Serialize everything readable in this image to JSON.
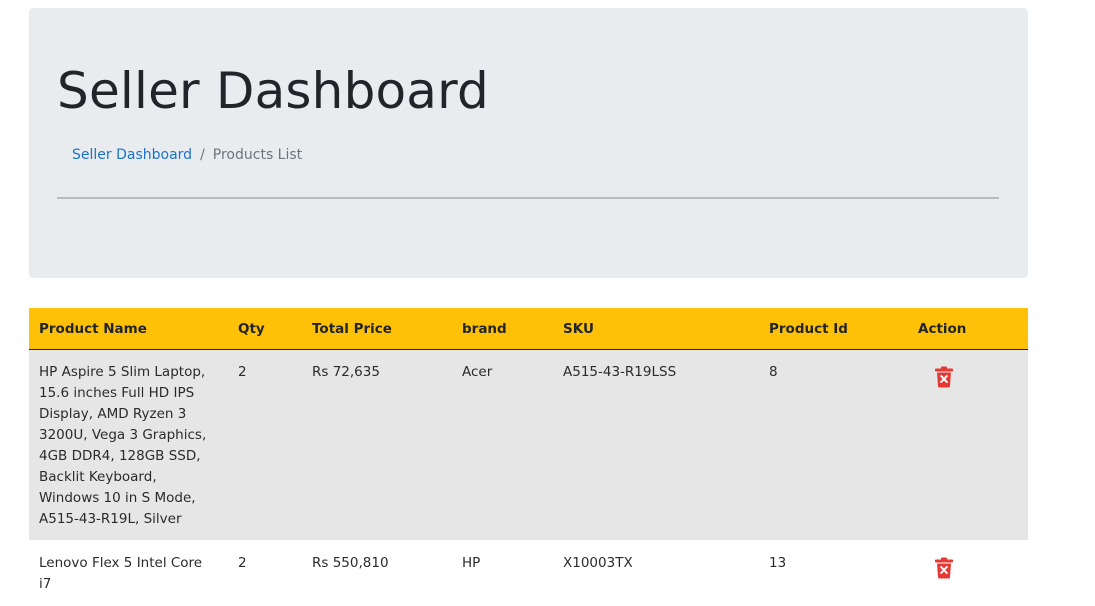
{
  "header": {
    "title": "Seller Dashboard",
    "breadcrumb": {
      "link_label": "Seller Dashboard",
      "separator": "/",
      "current": "Products List"
    }
  },
  "table": {
    "columns": [
      "Product Name",
      "Qty",
      "Total Price",
      "brand",
      "SKU",
      "Product Id",
      "Action"
    ],
    "rows": [
      {
        "name": "HP Aspire 5 Slim Laptop, 15.6 inches Full HD IPS Display, AMD Ryzen 3 3200U, Vega 3 Graphics, 4GB DDR4, 128GB SSD, Backlit Keyboard, Windows 10 in S Mode, A515-43-R19L, Silver",
        "qty": "2",
        "price": "Rs 72,635",
        "brand": "Acer",
        "sku": "A515-43-R19LSS",
        "id": "8",
        "action_icon": "trash-x-icon"
      },
      {
        "name": "Lenovo Flex 5 Intel Core i7",
        "qty": "2",
        "price": "Rs 550,810",
        "brand": "HP",
        "sku": "X10003TX",
        "id": "13",
        "action_icon": "trash-x-icon"
      }
    ]
  },
  "colors": {
    "header_bg": "#ffc107",
    "jumbotron_bg": "#e9ecef",
    "link": "#1a73c9",
    "delete_icon": "#e53935"
  }
}
